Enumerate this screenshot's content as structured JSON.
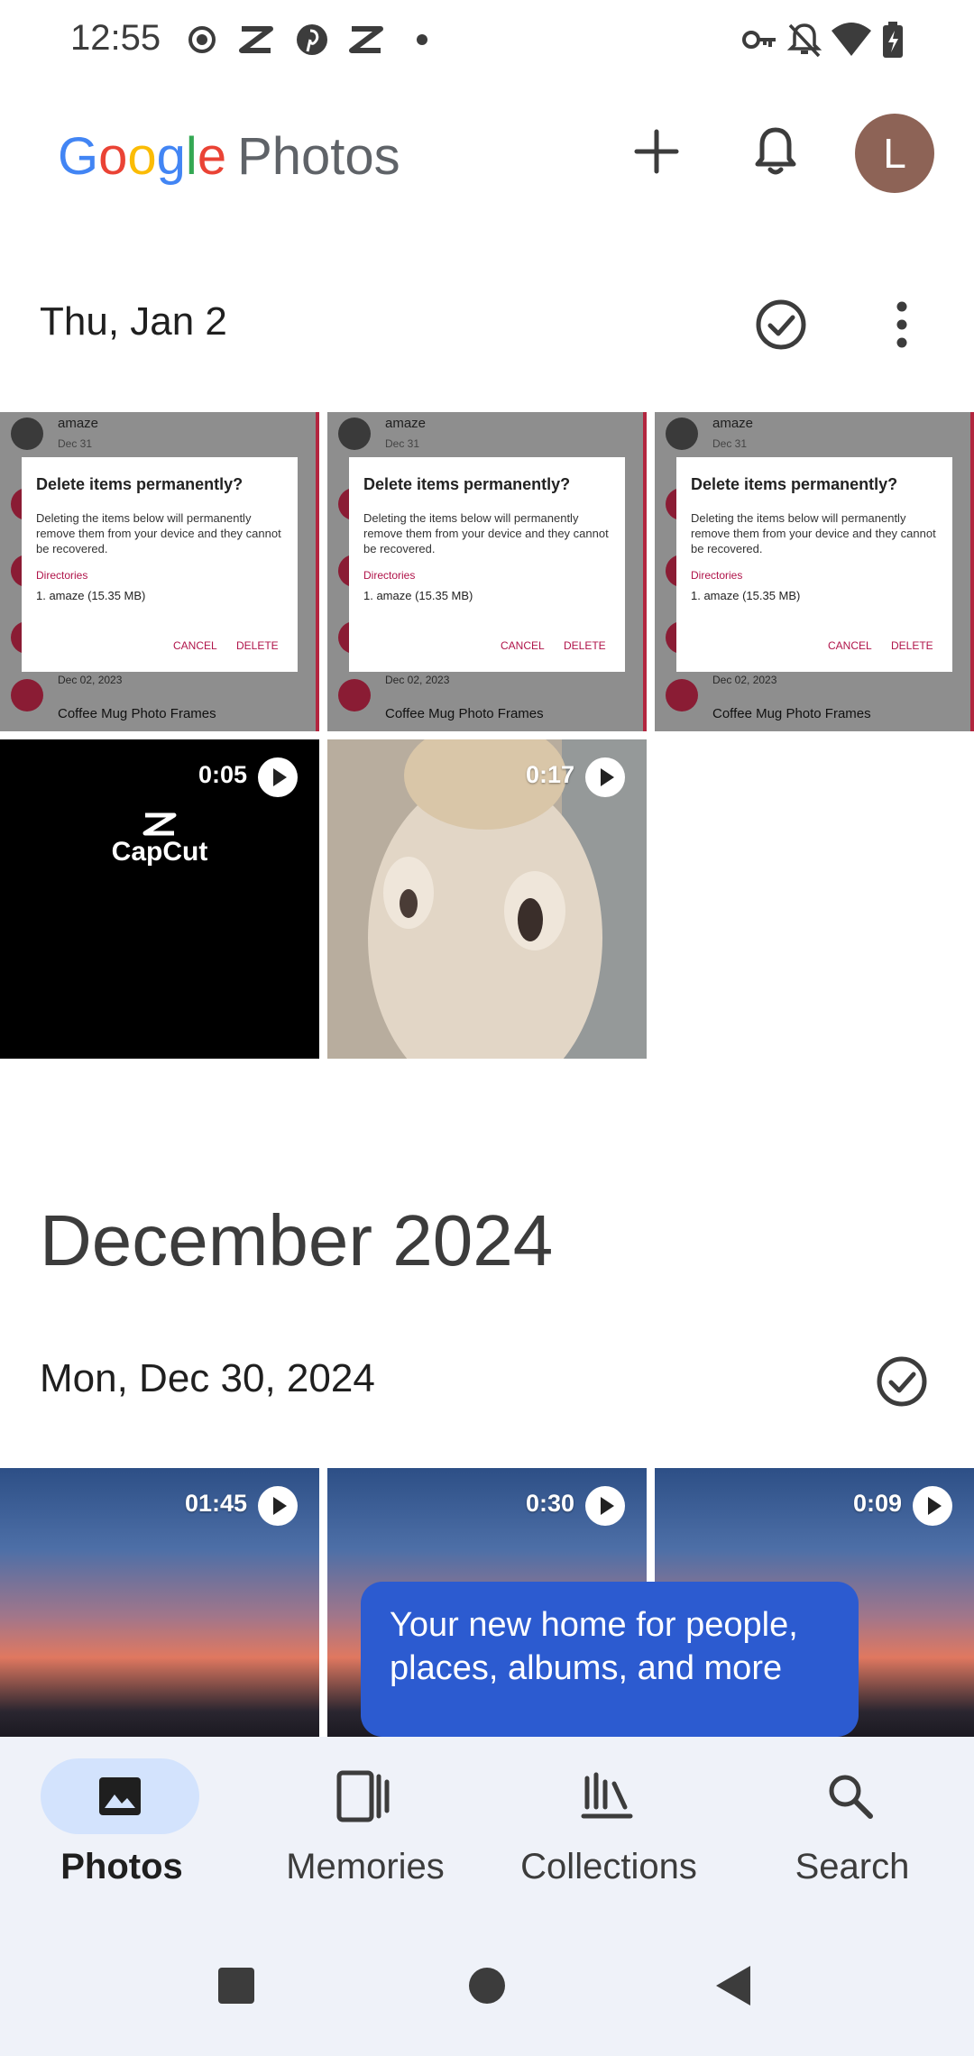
{
  "status_bar": {
    "time": "12:55",
    "left_icons": [
      "record-icon",
      "capcut-icon",
      "pinterest-icon",
      "capcut-icon",
      "dot-icon"
    ],
    "right_icons": [
      "vpn-key-icon",
      "notifications-off-icon",
      "wifi-icon",
      "battery-charging-icon"
    ]
  },
  "app_bar": {
    "logo_google": "Google",
    "logo_photos": "Photos",
    "avatar_initial": "L"
  },
  "sections": [
    {
      "date_label": "Thu, Jan 2"
    },
    {
      "month_heading": "December 2024",
      "date_label": "Mon, Dec 30, 2024"
    }
  ],
  "screenshot_thumb": {
    "app": "amaze",
    "app_date": "Dec 31",
    "dialog_title": "Delete items permanently?",
    "dialog_body": "Deleting the items below will permanently remove them from your device and they cannot be recovered.",
    "directories_label": "Directories",
    "item": "1. amaze (15.35 MB)",
    "cancel": "CANCEL",
    "delete": "DELETE",
    "list_date": "Dec 02, 2023",
    "list_item": "Coffee Mug Photo Frames"
  },
  "videos_jan2": [
    {
      "duration": "0:05",
      "overlay_text": "CapCut"
    },
    {
      "duration": "0:17"
    }
  ],
  "videos_dec30": [
    {
      "duration": "01:45"
    },
    {
      "duration": "0:30"
    },
    {
      "duration": "0:09"
    }
  ],
  "tooltip": {
    "text": "Your new home for people, places, albums, and more"
  },
  "bottom_nav": {
    "items": [
      {
        "label": "Photos",
        "icon": "photo-icon",
        "active": true
      },
      {
        "label": "Memories",
        "icon": "memories-icon",
        "active": false
      },
      {
        "label": "Collections",
        "icon": "collections-icon",
        "active": false
      },
      {
        "label": "Search",
        "icon": "search-icon",
        "active": false
      }
    ]
  },
  "colors": {
    "accent": "#2c5bd0",
    "nav_active_pill": "#d3e3fd",
    "nav_background": "#eff2f9"
  }
}
